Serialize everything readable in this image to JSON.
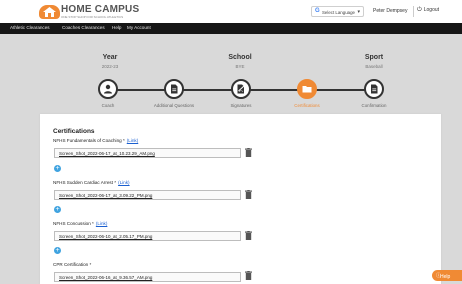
{
  "header": {
    "brand": "HOME CAMPUS",
    "tagline": "ONE STOP SHOP FOR SCHOOL ATHLETICS",
    "language": "Select Language",
    "user": "Peter Dempsey",
    "logout": "Logout"
  },
  "nav": {
    "items": [
      "Athletic Clearances",
      "Coaches Clearances",
      "Help",
      "My Account"
    ]
  },
  "sections": [
    {
      "title": "Year",
      "value": "2022-23"
    },
    {
      "title": "School",
      "value": "BYE"
    },
    {
      "title": "Sport",
      "value": "Baseball"
    }
  ],
  "steps": [
    {
      "label": "Coach",
      "icon": "user-icon"
    },
    {
      "label": "Additional Questions",
      "icon": "document-icon"
    },
    {
      "label": "Signatures",
      "icon": "signature-icon"
    },
    {
      "label": "Certifications",
      "icon": "folder-icon"
    },
    {
      "label": "Confirmation",
      "icon": "document-icon"
    }
  ],
  "colors": {
    "accent": "#f08a34",
    "add": "#3fa3e0",
    "link": "#1a5fd0"
  },
  "card": {
    "title": "Certifications",
    "link_text": "(Link)",
    "items": [
      {
        "label": "NFHS Fundamentals of Coaching *",
        "has_link": true,
        "file": "Screen_Shot_2022-06-17_at_10.23.29_AM.png"
      },
      {
        "label": "NFHS Sudden Cardiac Arrest *",
        "has_link": true,
        "file": "Screen_Shot_2022-06-17_at_3.09.22_PM.png"
      },
      {
        "label": "NFHS Concussion *",
        "has_link": true,
        "file": "Screen_Shot_2022-06-10_at_2.05.17_PM.png"
      },
      {
        "label": "CPR Certification *",
        "has_link": false,
        "file": "Screen_Shot_2022-06-16_at_9.36.57_AM.png"
      }
    ]
  },
  "help": {
    "label": "Help"
  }
}
